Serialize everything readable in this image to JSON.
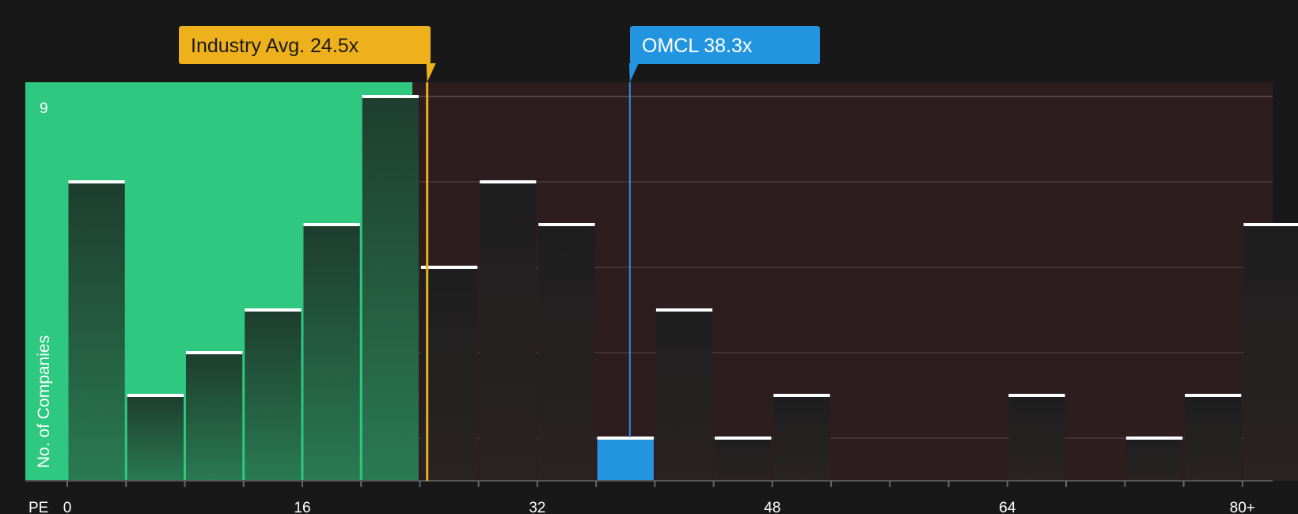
{
  "chart_data": {
    "type": "bar",
    "xlabel": "PE",
    "ylabel": "No. of Companies",
    "ylim": [
      0,
      9
    ],
    "y_tick_labels": [
      {
        "value": 9,
        "label": "9"
      }
    ],
    "x_ticks": [
      {
        "value": 0,
        "label": "0"
      },
      {
        "value": 16,
        "label": "16"
      },
      {
        "value": 32,
        "label": "32"
      },
      {
        "value": 48,
        "label": "48"
      },
      {
        "value": 64,
        "label": "64"
      },
      {
        "value": 80,
        "label": "80+"
      }
    ],
    "bin_width": 4,
    "bins": [
      {
        "start": 0,
        "count": 7
      },
      {
        "start": 4,
        "count": 2
      },
      {
        "start": 8,
        "count": 3
      },
      {
        "start": 12,
        "count": 4
      },
      {
        "start": 16,
        "count": 6
      },
      {
        "start": 20,
        "count": 9
      },
      {
        "start": 24,
        "count": 5
      },
      {
        "start": 28,
        "count": 7
      },
      {
        "start": 32,
        "count": 6
      },
      {
        "start": 36,
        "count": 1,
        "highlight": true
      },
      {
        "start": 40,
        "count": 4
      },
      {
        "start": 44,
        "count": 1
      },
      {
        "start": 48,
        "count": 2
      },
      {
        "start": 64,
        "count": 2
      },
      {
        "start": 72,
        "count": 1
      },
      {
        "start": 76,
        "count": 2
      },
      {
        "start": 80,
        "count": 6
      }
    ],
    "fair_zone_end": 23.5,
    "industry_avg": {
      "label": "Industry Avg. 24.5x",
      "value": 24.5
    },
    "company": {
      "label": "OMCL 38.3x",
      "value": 38.3
    },
    "grid": true,
    "colors": {
      "background": "#181818",
      "fair_zone": "#2ec880",
      "high_zone": "#2e1d1e",
      "bar_in_fair": "#1f4a36",
      "bar_in_high": "#221f20",
      "highlight_bar": "#2394e0",
      "bar_cap": "#ffffff",
      "industry_callout": "#efb11b",
      "company_callout": "#2394e0"
    }
  }
}
